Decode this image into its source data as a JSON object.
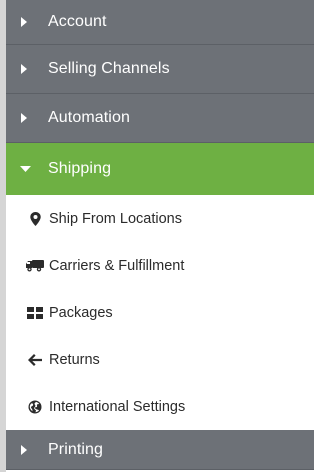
{
  "menu": {
    "sections": [
      {
        "label": "Account",
        "icon": "caret-right-icon"
      },
      {
        "label": "Selling Channels",
        "icon": "caret-right-icon"
      },
      {
        "label": "Automation",
        "icon": "caret-right-icon"
      },
      {
        "label": "Shipping",
        "icon": "caret-down-icon",
        "expanded": true
      },
      {
        "label": "Printing",
        "icon": "caret-right-icon"
      }
    ],
    "shipping_items": [
      {
        "label": "Ship From Locations",
        "icon": "map-marker-icon"
      },
      {
        "label": "Carriers & Fulfillment",
        "icon": "truck-icon"
      },
      {
        "label": "Packages",
        "icon": "grid-icon"
      },
      {
        "label": "Returns",
        "icon": "arrow-left-icon"
      },
      {
        "label": "International Settings",
        "icon": "globe-icon"
      }
    ]
  },
  "colors": {
    "collapsed_section": "#6d7177",
    "active_section": "#6eb043",
    "sub_text": "#2b2b2b"
  }
}
